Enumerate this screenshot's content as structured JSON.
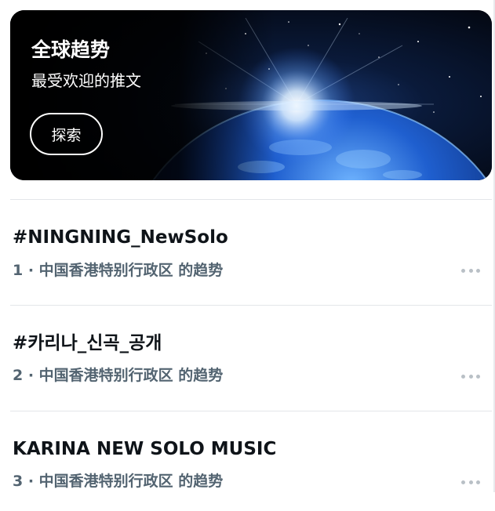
{
  "banner": {
    "title": "全球趋势",
    "subtitle": "最受欢迎的推文",
    "explore_label": "探索"
  },
  "trends": [
    {
      "rank": "1",
      "name": "#NINGNING_NewSolo",
      "meta": "1 · 中国香港特别行政区 的趋势"
    },
    {
      "rank": "2",
      "name": "#카리나_신곡_공개",
      "meta": "2 · 中国香港特别行政区 的趋势"
    },
    {
      "rank": "3",
      "name": "KARINA NEW SOLO MUSIC",
      "meta": "3 · 中国香港特别行政区 的趋势"
    }
  ],
  "icons": {
    "more": "more-horizontal-icon"
  },
  "colors": {
    "text_primary": "#0f1419",
    "text_secondary": "#536471",
    "divider": "#e3e6e9",
    "banner_bg": "#02050c"
  }
}
